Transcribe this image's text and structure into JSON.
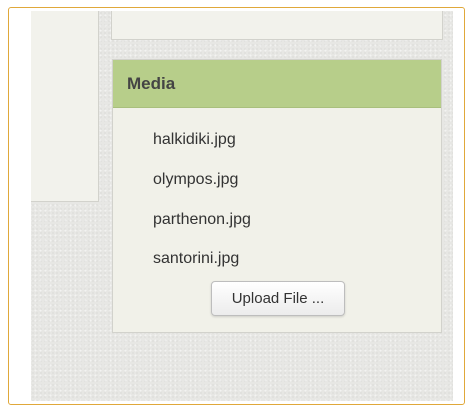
{
  "media": {
    "title": "Media",
    "files": [
      "halkidiki.jpg",
      "olympos.jpg",
      "parthenon.jpg",
      "santorini.jpg"
    ],
    "upload_label": "Upload File ..."
  },
  "colors": {
    "frame_border": "#e0a83a",
    "header_bg": "#b7ce8a",
    "panel_bg": "#f1f1e9"
  }
}
